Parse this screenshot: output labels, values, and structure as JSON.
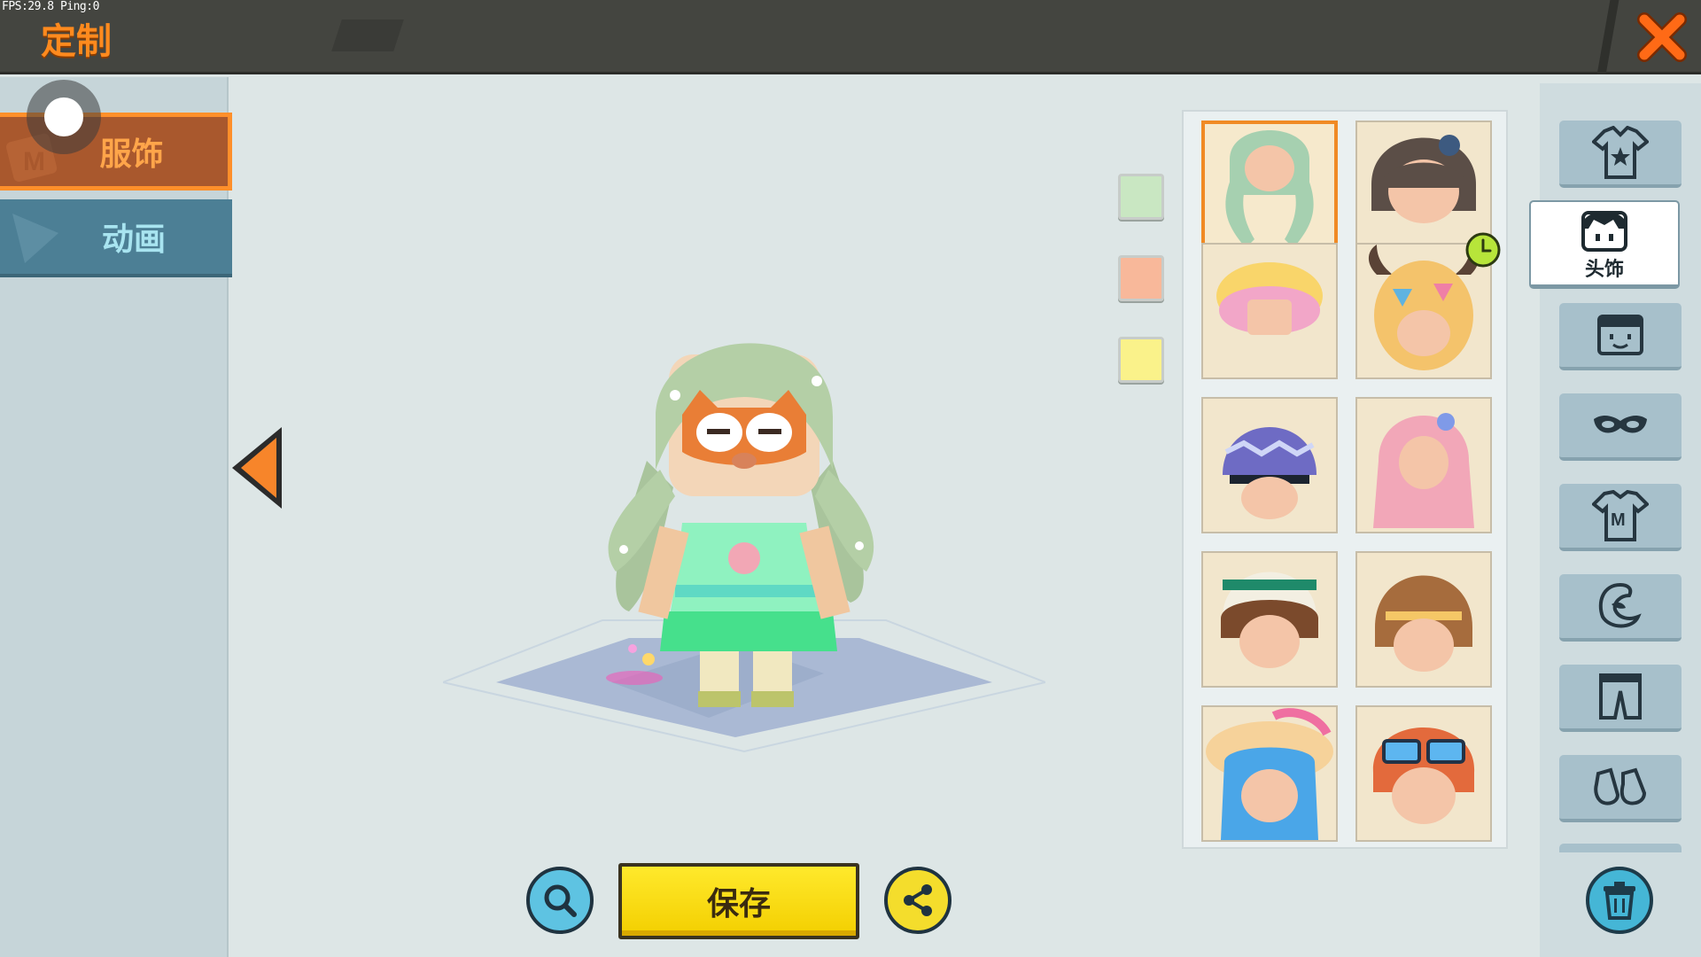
{
  "hud": {
    "debug": "FPS:29.8  Ping:0"
  },
  "header": {
    "title": "定制",
    "close_icon": "close-x-icon",
    "accent": "#ff8a1e"
  },
  "left_tabs": [
    {
      "label": "服饰",
      "state": "selected",
      "color": "#a9582d"
    },
    {
      "label": "动画",
      "state": "normal",
      "color": "#4c7f95"
    }
  ],
  "color_swatches": [
    "#c9e7c2",
    "#f8b89a",
    "#faf28a"
  ],
  "items": [
    {
      "name": "mint-twin-braids-hair",
      "selected": true
    },
    {
      "name": "dark-hair-with-goggles"
    },
    {
      "name": "pink-sunhat-curly-hair"
    },
    {
      "name": "horned-egg-helmet",
      "timed": true
    },
    {
      "name": "purple-zigzag-cap"
    },
    {
      "name": "pink-flower-crown-hair"
    },
    {
      "name": "green-band-cap-brown-hair"
    },
    {
      "name": "brown-hair-headband"
    },
    {
      "name": "blue-hair-pink-sunhat"
    },
    {
      "name": "red-hair-sunglasses"
    }
  ],
  "rail": {
    "active_label": "头饰",
    "categories": [
      "outfit-set-icon",
      "headwear-icon",
      "face-icon",
      "mask-icon",
      "shirt-icon",
      "cape-icon",
      "pants-icon",
      "shoes-icon"
    ]
  },
  "buttons": {
    "save_label": "保存"
  }
}
